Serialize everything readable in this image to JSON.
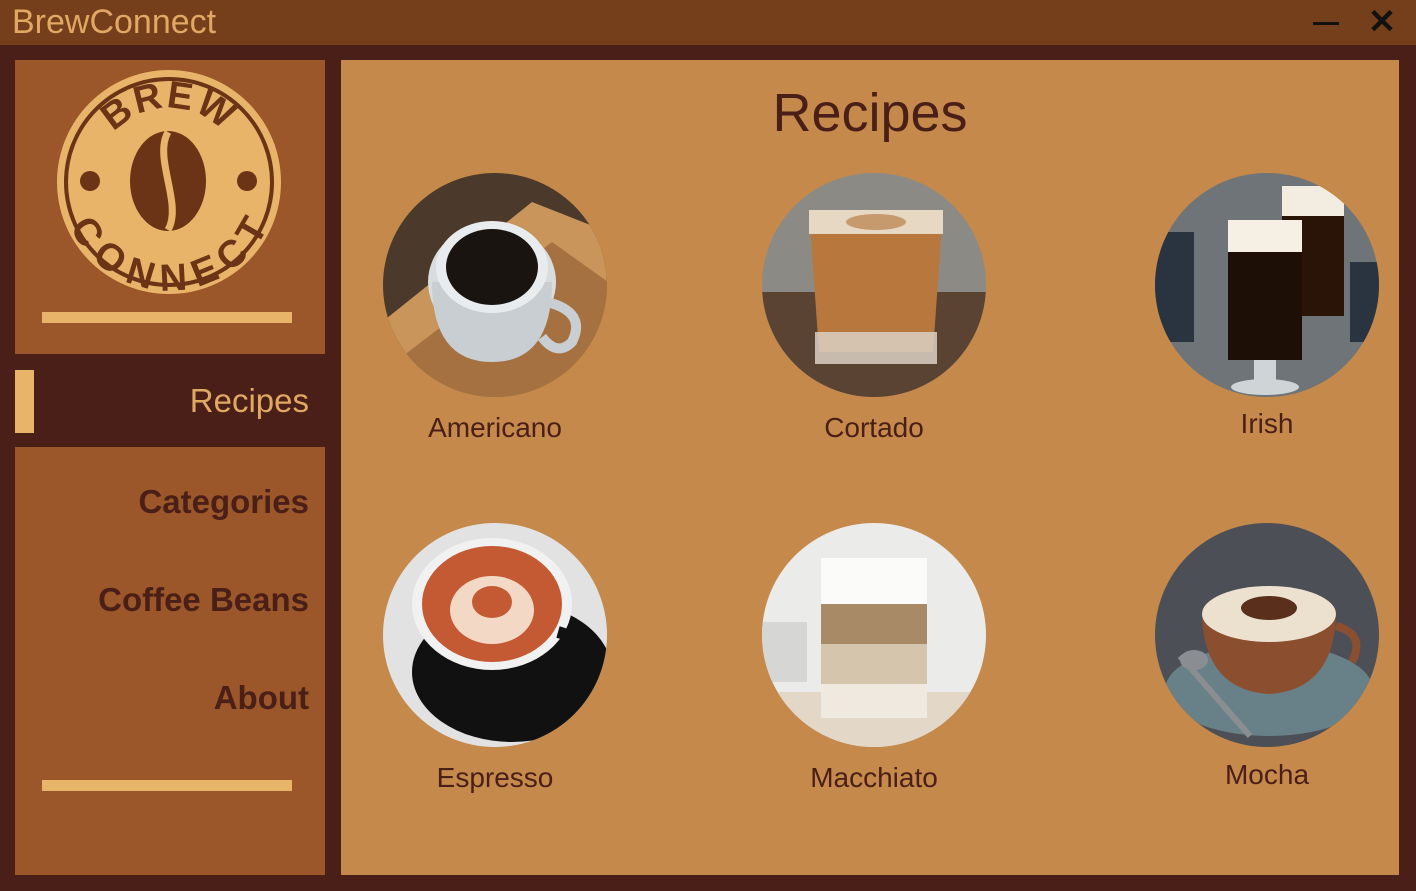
{
  "window": {
    "title": "BrewConnect"
  },
  "logo": {
    "top_text": "BREW",
    "bottom_text": "CONNECT"
  },
  "nav": {
    "active": "Recipes",
    "items": [
      "Categories",
      "Coffee Beans",
      "About"
    ]
  },
  "main": {
    "title": "Recipes",
    "recipes": [
      {
        "name": "Americano"
      },
      {
        "name": "Cortado"
      },
      {
        "name": "Irish"
      },
      {
        "name": "Espresso"
      },
      {
        "name": "Macchiato"
      },
      {
        "name": "Mocha"
      }
    ]
  },
  "colors": {
    "titlebar": "#743f1a",
    "background": "#4a1f17",
    "sidebar": "#9b5629",
    "accent": "#e8b46a",
    "content": "#c4894b"
  }
}
